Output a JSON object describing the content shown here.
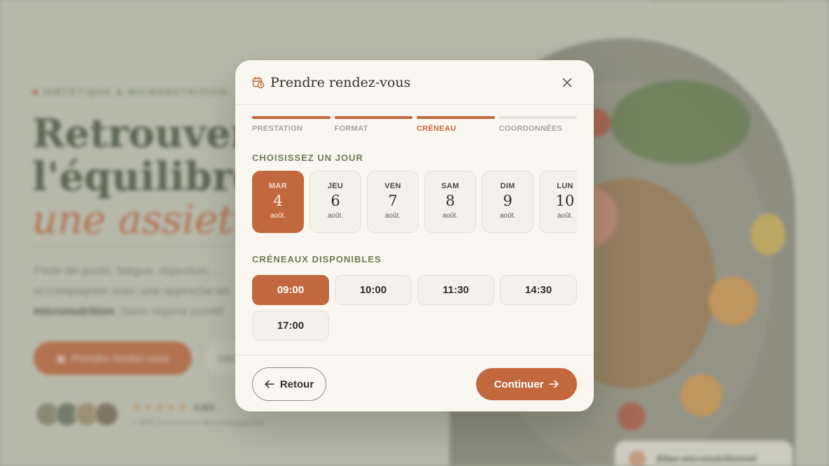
{
  "background": {
    "eyebrow": "DIÉTÉTIQUE & MICRONUTRITION",
    "title_line1": "Retrouver",
    "title_line2": "l'équilibre,",
    "title_line3": "une assiette",
    "description_start": "Perte de poids, fatigue, digestion, ... accompagnée avec une approche en ",
    "description_bold": "micronutrition",
    "description_end": ". Sans régime punitif.",
    "cta_primary": "Prendre rendez-vous",
    "cta_secondary": "Découvrir",
    "rating_stars": "★★★★★",
    "rating_value": "4,9/5",
    "rating_sub": "+ 800 personnes accompagnées",
    "badge_text": "Bilan micronutritionnel"
  },
  "modal": {
    "title": "Prendre rendez-vous",
    "steps": [
      {
        "label": "PRESTATION",
        "state": "done"
      },
      {
        "label": "FORMAT",
        "state": "done"
      },
      {
        "label": "CRÉNEAU",
        "state": "current"
      },
      {
        "label": "COORDONNÉES",
        "state": "todo"
      }
    ],
    "days_title": "CHOISISSEZ UN JOUR",
    "days": [
      {
        "dow": "MAR",
        "num": "4",
        "month": "août.",
        "selected": true
      },
      {
        "dow": "JEU",
        "num": "6",
        "month": "août.",
        "selected": false
      },
      {
        "dow": "VEN",
        "num": "7",
        "month": "août.",
        "selected": false
      },
      {
        "dow": "SAM",
        "num": "8",
        "month": "août.",
        "selected": false
      },
      {
        "dow": "DIM",
        "num": "9",
        "month": "août.",
        "selected": false
      },
      {
        "dow": "LUN",
        "num": "10",
        "month": "août.",
        "selected": false
      }
    ],
    "slots_title": "CRÉNEAUX DISPONIBLES",
    "slots": [
      {
        "time": "09:00",
        "selected": true
      },
      {
        "time": "10:00",
        "selected": false
      },
      {
        "time": "11:30",
        "selected": false
      },
      {
        "time": "14:30",
        "selected": false
      },
      {
        "time": "17:00",
        "selected": false
      }
    ],
    "back_label": "Retour",
    "continue_label": "Continuer"
  },
  "colors": {
    "accent": "#c2683f",
    "sage": "#6d7c59",
    "modal_bg": "#faf7f1"
  },
  "icons": {
    "header": "calendar-clock-icon",
    "close": "close-icon",
    "back": "arrow-left-icon",
    "continue": "arrow-right-icon"
  }
}
